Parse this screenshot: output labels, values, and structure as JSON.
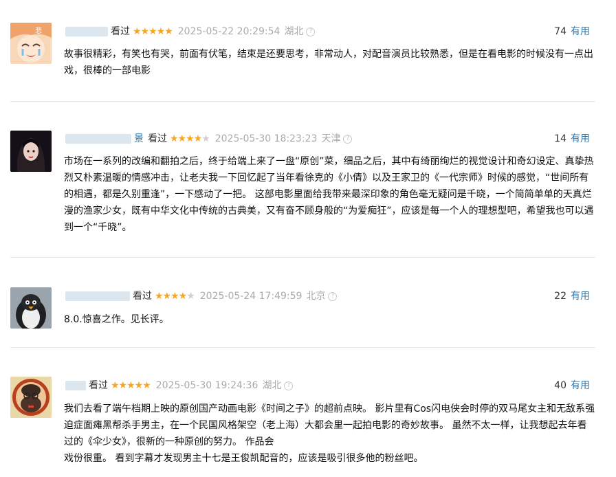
{
  "reviews": [
    {
      "user_tail": "",
      "watched_label": "看过",
      "stars_on": "★★★★★",
      "stars_off": "",
      "time": "2025-05-22 20:29:54",
      "location": "湖北",
      "votes": "74",
      "useful_label": "有用",
      "text": "故事很精彩，有笑也有哭，前面有伏笔，结束是还要思考，非常动人，对配音演员比较熟悉，但是在看电影的时候没有一点出戏，很棒的一部电影"
    },
    {
      "user_tail": "景",
      "watched_label": "看过",
      "stars_on": "★★★★",
      "stars_off": "★",
      "time": "2025-05-30 18:23:23",
      "location": "天津",
      "votes": "14",
      "useful_label": "有用",
      "text": "市场在一系列的改编和翻拍之后，终于给端上来了一盘“原创”菜，细品之后，其中有绮丽绚烂的视觉设计和奇幻设定、真挚热烈又朴素温暖的情感冲击，让老夫我一下回忆起了当年看徐克的《小倩》以及王家卫的《一代宗师》时候的感觉，“世间所有的相遇，都是久别重逢”，一下感动了一把。 这部电影里面给我带来最深印象的角色毫无疑问是千晓，一个简简单单的天真烂漫的渔家少女，既有中华文化中传统的古典美，又有奋不顾身般的“为爱痴狂”，应该是每一个人的理想型吧，希望我也可以遇到一个“千晓”。"
    },
    {
      "user_tail": "",
      "watched_label": "看过",
      "stars_on": "★★★★",
      "stars_off": "★",
      "time": "2025-05-24 17:49:59",
      "location": "北京",
      "votes": "22",
      "useful_label": "有用",
      "text": "8.0.惊喜之作。见长评。"
    },
    {
      "user_tail": "",
      "watched_label": "看过",
      "stars_on": "★★★★★",
      "stars_off": "",
      "time": "2025-05-30 19:24:36",
      "location": "湖北",
      "votes": "40",
      "useful_label": "有用",
      "text": "我们去看了端午档期上映的原创国产动画电影《时间之子》的超前点映。 影片里有Cos闪电侠会时停的双马尾女主和无敌系强迫症面瘫黑帮杀手男主，在一个民国风格架空（老上海）大都会里一起拍电影的奇妙故事。 虽然不太一样，让我想起去年看过的《伞少女》，很新的一种原创的努力。 作品会",
      "text_tail": "戏份很重。 看到字幕才发现男主十七是王俊凯配音的，应该是吸引很多他的粉丝吧。"
    }
  ],
  "colors": {
    "link": "#3377aa",
    "star": "#f6a623",
    "muted": "#aaaaaa"
  }
}
